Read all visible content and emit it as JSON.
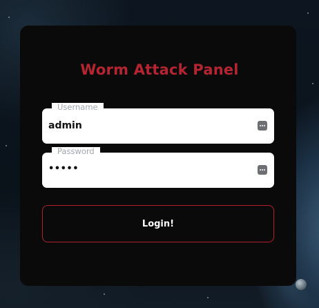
{
  "panel": {
    "title": "Worm Attack Panel"
  },
  "form": {
    "username": {
      "label": "Username",
      "value": "admin",
      "icon": "password-manager-icon"
    },
    "password": {
      "label": "Password",
      "value": "•••••",
      "icon": "password-manager-icon"
    },
    "login_label": "Login!"
  },
  "colors": {
    "title": "#b52431",
    "button_border": "#b21f2d",
    "panel_bg": "#0a0a0a",
    "label": "#a2a6ad"
  }
}
